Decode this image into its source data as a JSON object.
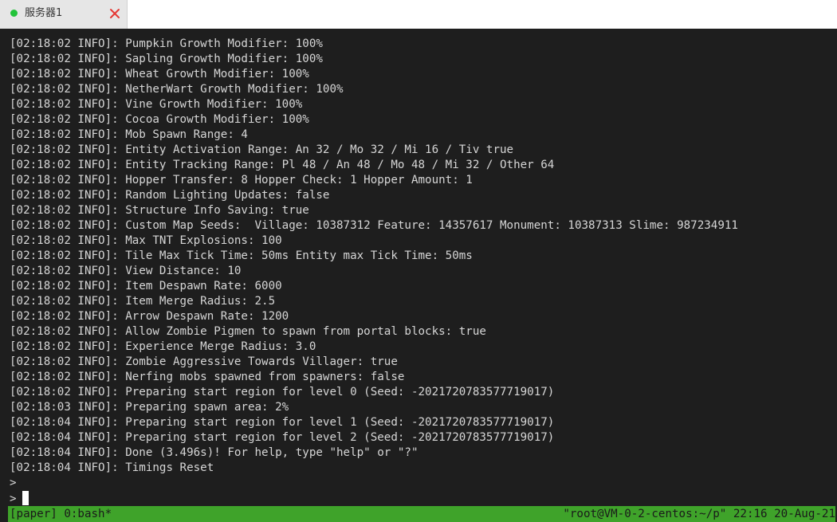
{
  "tab": {
    "title": "服务器1",
    "status_color": "#22c33a",
    "close_color": "#e53935"
  },
  "terminal": {
    "lines": [
      "[02:18:02 INFO]: Pumpkin Growth Modifier: 100%",
      "[02:18:02 INFO]: Sapling Growth Modifier: 100%",
      "[02:18:02 INFO]: Wheat Growth Modifier: 100%",
      "[02:18:02 INFO]: NetherWart Growth Modifier: 100%",
      "[02:18:02 INFO]: Vine Growth Modifier: 100%",
      "[02:18:02 INFO]: Cocoa Growth Modifier: 100%",
      "[02:18:02 INFO]: Mob Spawn Range: 4",
      "[02:18:02 INFO]: Entity Activation Range: An 32 / Mo 32 / Mi 16 / Tiv true",
      "[02:18:02 INFO]: Entity Tracking Range: Pl 48 / An 48 / Mo 48 / Mi 32 / Other 64",
      "[02:18:02 INFO]: Hopper Transfer: 8 Hopper Check: 1 Hopper Amount: 1",
      "[02:18:02 INFO]: Random Lighting Updates: false",
      "[02:18:02 INFO]: Structure Info Saving: true",
      "[02:18:02 INFO]: Custom Map Seeds:  Village: 10387312 Feature: 14357617 Monument: 10387313 Slime: 987234911",
      "[02:18:02 INFO]: Max TNT Explosions: 100",
      "[02:18:02 INFO]: Tile Max Tick Time: 50ms Entity max Tick Time: 50ms",
      "[02:18:02 INFO]: View Distance: 10",
      "[02:18:02 INFO]: Item Despawn Rate: 6000",
      "[02:18:02 INFO]: Item Merge Radius: 2.5",
      "[02:18:02 INFO]: Arrow Despawn Rate: 1200",
      "[02:18:02 INFO]: Allow Zombie Pigmen to spawn from portal blocks: true",
      "[02:18:02 INFO]: Experience Merge Radius: 3.0",
      "[02:18:02 INFO]: Zombie Aggressive Towards Villager: true",
      "[02:18:02 INFO]: Nerfing mobs spawned from spawners: false",
      "[02:18:02 INFO]: Preparing start region for level 0 (Seed: -2021720783577719017)",
      "[02:18:03 INFO]: Preparing spawn area: 2%",
      "[02:18:04 INFO]: Preparing start region for level 1 (Seed: -2021720783577719017)",
      "[02:18:04 INFO]: Preparing start region for level 2 (Seed: -2021720783577719017)",
      "[02:18:04 INFO]: Done (3.496s)! For help, type \"help\" or \"?\"",
      "[02:18:04 INFO]: Timings Reset"
    ],
    "prompts": [
      ">",
      ">"
    ]
  },
  "statusbar": {
    "left": "[paper] 0:bash*",
    "right": "\"root@VM-0-2-centos:~/p\" 22:16 20-Aug-21",
    "background": "#3fa32a"
  }
}
